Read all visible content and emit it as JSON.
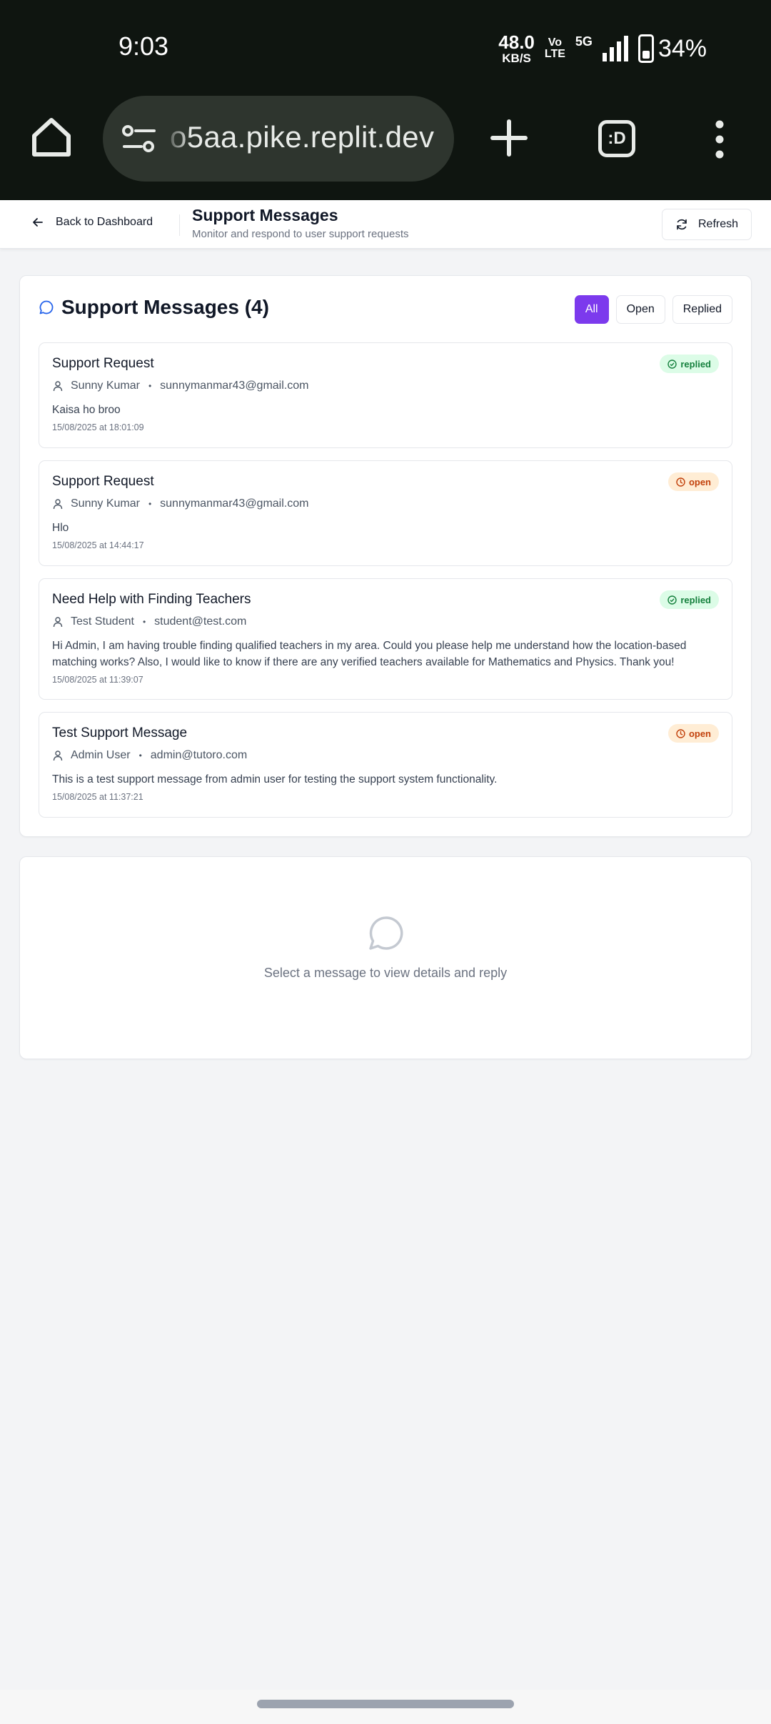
{
  "status_bar": {
    "time": "9:03",
    "net_speed_value": "48.0",
    "net_speed_unit": "KB/S",
    "volte_top": "Vo",
    "volte_bottom": "LTE",
    "network": "5G",
    "battery": "34%"
  },
  "browser": {
    "url": "o5aa.pike.replit.dev",
    "tabs_label": ":D",
    "icons": [
      "home-icon",
      "tune-icon",
      "plus-icon",
      "tab-switcher-icon",
      "more-vert-icon"
    ]
  },
  "header": {
    "back_label": "Back to Dashboard",
    "title": "Support Messages",
    "subtitle": "Monitor and respond to user support requests",
    "refresh_label": "Refresh"
  },
  "messages_panel": {
    "title": "Support Messages (4)",
    "filters": [
      {
        "label": "All",
        "active": true
      },
      {
        "label": "Open",
        "active": false
      },
      {
        "label": "Replied",
        "active": false
      }
    ],
    "messages": [
      {
        "subject": "Support Request",
        "name": "Sunny Kumar",
        "email": "sunnymanmar43@gmail.com",
        "body": "Kaisa ho broo",
        "timestamp": "15/08/2025 at 18:01:09",
        "status": "replied"
      },
      {
        "subject": "Support Request",
        "name": "Sunny Kumar",
        "email": "sunnymanmar43@gmail.com",
        "body": "Hlo",
        "timestamp": "15/08/2025 at 14:44:17",
        "status": "open"
      },
      {
        "subject": "Need Help with Finding Teachers",
        "name": "Test Student",
        "email": "student@test.com",
        "body": "Hi Admin, I am having trouble finding qualified teachers in my area. Could you please help me understand how the location-based matching works? Also, I would like to know if there are any verified teachers available for Mathematics and Physics. Thank you!",
        "timestamp": "15/08/2025 at 11:39:07",
        "status": "replied"
      },
      {
        "subject": "Test Support Message",
        "name": "Admin User",
        "email": "admin@tutoro.com",
        "body": "This is a test support message from admin user for testing the support system functionality.",
        "timestamp": "15/08/2025 at 11:37:21",
        "status": "open"
      }
    ]
  },
  "detail_panel": {
    "empty_text": "Select a message to view details and reply"
  },
  "colors": {
    "accent": "#7c3aed",
    "replied_bg": "#dcfce7",
    "replied_fg": "#15803d",
    "open_bg": "#ffedd5",
    "open_fg": "#c2410c"
  }
}
